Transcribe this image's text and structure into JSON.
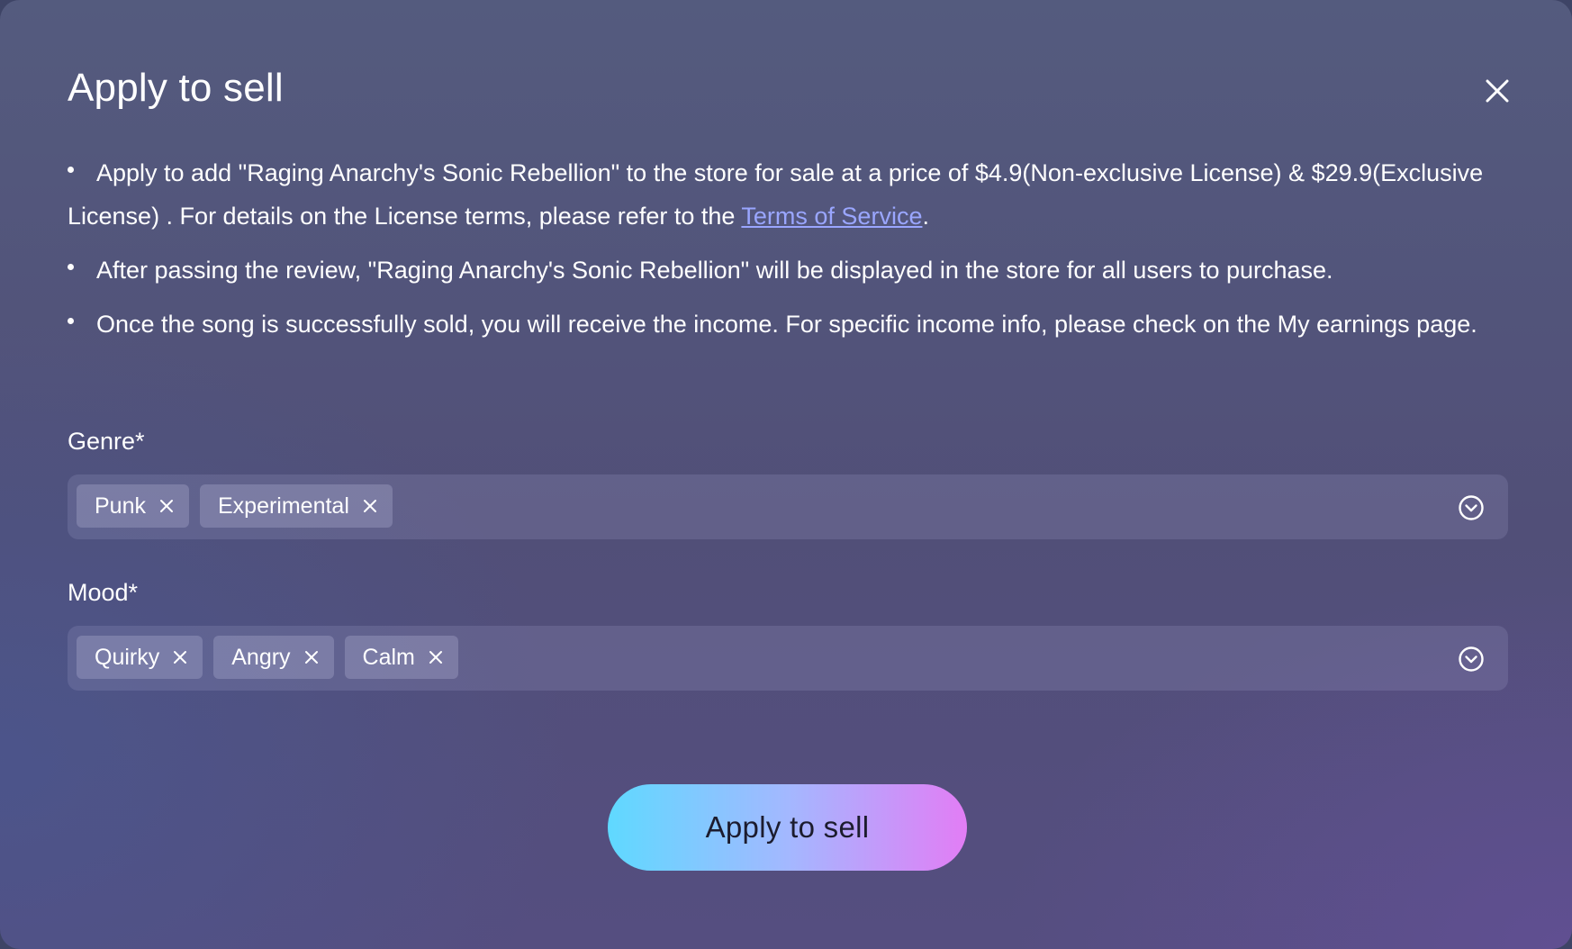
{
  "dialog": {
    "title": "Apply to sell",
    "close_icon": "close-icon"
  },
  "info": {
    "item1_text_a": "Apply to add \"Raging Anarchy's Sonic Rebellion\" to the store for sale at a price of $4.9(Non-exclusive License) & $29.9(Exclusive License) . For details on the License terms, please refer to the ",
    "item1_link": "Terms of Service",
    "item1_text_b": ".",
    "item2_text": "After passing the review, \"Raging Anarchy's Sonic Rebellion\" will be displayed in the store for all users to purchase.",
    "item3_text": "Once the song is successfully sold, you will receive the income. For specific income info, please check on the My earnings page."
  },
  "genre": {
    "label": "Genre*",
    "tags": [
      "Punk",
      "Experimental"
    ],
    "dropdown_icon": "chevron-down-circle-icon"
  },
  "mood": {
    "label": "Mood*",
    "tags": [
      "Quirky",
      "Angry",
      "Calm"
    ],
    "dropdown_icon": "chevron-down-circle-icon"
  },
  "actions": {
    "submit_label": "Apply to sell"
  },
  "colors": {
    "link": "#9aa6ff",
    "button_gradient_start": "#5fd9ff",
    "button_gradient_end": "#e27df5"
  }
}
